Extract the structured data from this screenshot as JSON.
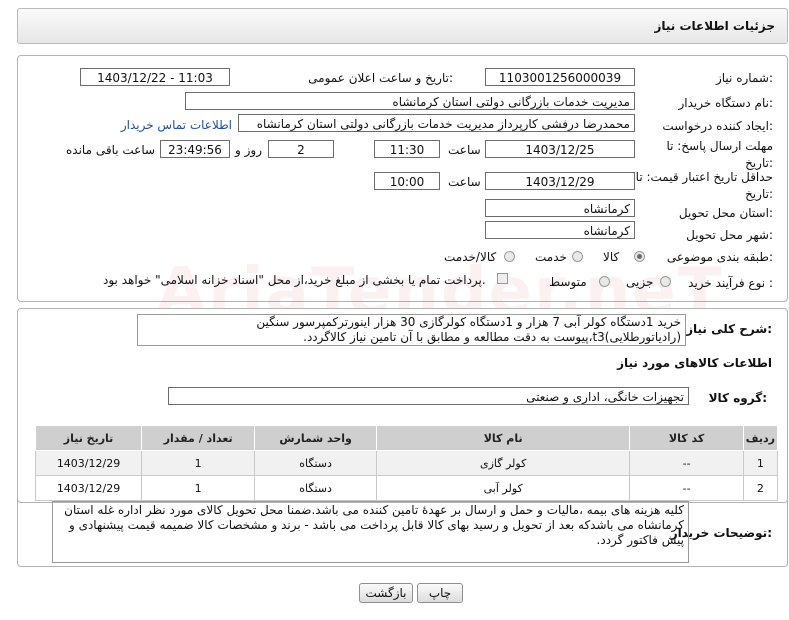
{
  "header": {
    "title": "جزئیات اطلاعات نیاز"
  },
  "watermark": "AriaTender.neT",
  "form": {
    "need_number": {
      "label": "شماره نیاز:",
      "value": "1103001256000039"
    },
    "announce": {
      "label": "تاریخ و ساعت اعلان عمومی:",
      "value": "1403/12/22 - 11:03"
    },
    "buyer_org": {
      "label": "نام دستگاه خریدار:",
      "value": "مدیریت خدمات بازرگانی دولتی استان کرمانشاه"
    },
    "requester": {
      "label": "ایجاد کننده درخواست:",
      "value": "محمدرضا درفشی کارپرداز مدیریت خدمات بازرگانی دولتی استان کرمانشاه",
      "contact_link": "اطلاعات تماس خریدار"
    },
    "deadline": {
      "label": "مهلت ارسال پاسخ: تا تاریخ:",
      "date": "1403/12/25",
      "time_label": "ساعت",
      "time": "11:30",
      "days": "2",
      "days_label": "روز و",
      "remaining": "23:49:56",
      "remaining_label": "ساعت باقی مانده"
    },
    "price_validity": {
      "label": "حداقل تاریخ اعتبار قیمت: تا تاریخ:",
      "date": "1403/12/29",
      "time_label": "ساعت",
      "time": "10:00"
    },
    "province": {
      "label": "استان محل تحویل:",
      "value": "کرمانشاه"
    },
    "city": {
      "label": "شهر محل تحویل:",
      "value": "کرمانشاه"
    },
    "category": {
      "label": "طبقه بندی موضوعی:",
      "options": [
        "کالا",
        "خدمت",
        "کالا/خدمت"
      ],
      "selected": "کالا"
    },
    "purchase_type": {
      "label": "نوع فرآیند خرید :",
      "options": [
        "جزیی",
        "متوسط"
      ],
      "note": "پرداخت تمام یا بخشی از مبلغ خرید،از محل \"اسناد خزانه اسلامی\" خواهد بود."
    }
  },
  "description": {
    "label": "شرح کلی نیاز:",
    "text": "خرید 1دستگاه کولر آبی 7 هزار و 1دستگاه کولرگازی 30 هزار اینورترکمپرسور سنگین (رادیاتورطلایی)t3،پیوست به دقت مطالعه و مطابق با آن تامین نیاز کالاگردد."
  },
  "goods": {
    "section_title": "اطلاعات کالاهای مورد نیاز",
    "group_label": "گروه کالا:",
    "group_value": "تجهیزات خانگی، اداری و صنعتی",
    "columns": [
      "ردیف",
      "کد کالا",
      "نام کالا",
      "واحد شمارش",
      "تعداد / مقدار",
      "تاریخ نیاز"
    ],
    "rows": [
      {
        "idx": "1",
        "code": "--",
        "name": "کولر گازی",
        "unit": "دستگاه",
        "qty": "1",
        "date": "1403/12/29"
      },
      {
        "idx": "2",
        "code": "--",
        "name": "کولر آبی",
        "unit": "دستگاه",
        "qty": "1",
        "date": "1403/12/29"
      }
    ]
  },
  "buyer_notes": {
    "label": "توضیحات خریدار:",
    "text": "کلیه هزینه های بیمه ،مالیات و حمل و ارسال بر عهدهٔ تامین کننده می باشد.ضمنا محل تحویل کالای مورد نظر اداره غله استان کرمانشاه می باشدکه بعد از تحویل و رسید بهای کالا قابل پرداخت می باشد - برند و مشخصات کالا ضمیمه قیمت پیشنهادی و پیش فاکتور گردد."
  },
  "buttons": {
    "print": "چاپ",
    "back": "بازگشت"
  }
}
